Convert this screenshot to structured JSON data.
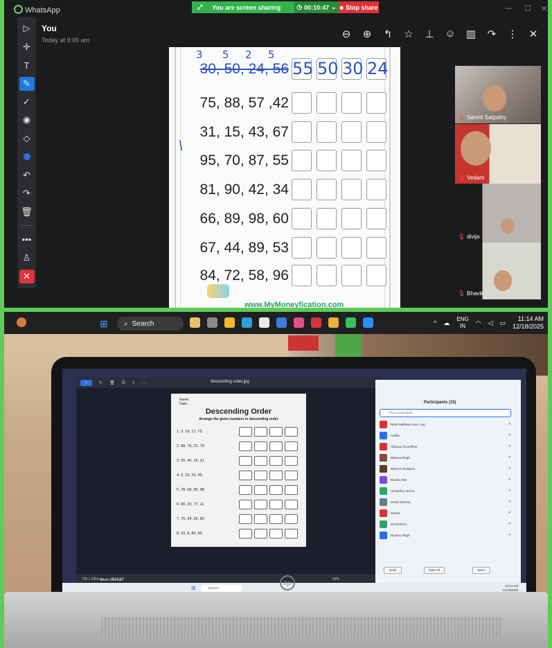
{
  "window": {
    "app_title": "WhatsApp",
    "minimize": "—",
    "maximize": "☐",
    "close": "✕"
  },
  "share_bar": {
    "status": "You are screen sharing",
    "timer": "00:10:47",
    "stop_label": "Stop share"
  },
  "viewer": {
    "sender": "You",
    "timestamp": "Today at 9:05 am",
    "actions": [
      "zoom-out-icon",
      "zoom-in-icon",
      "reply-icon",
      "star-icon",
      "pin-icon",
      "emoji-icon",
      "delete-icon",
      "forward-icon",
      "more-icon",
      "close-icon"
    ]
  },
  "toolbar": {
    "tools": [
      "select-icon",
      "move-icon",
      "text-icon",
      "pen-icon",
      "check-icon",
      "highlight-icon",
      "eraser-icon",
      "color-icon",
      "undo-icon",
      "redo-icon",
      "delete-icon",
      "more-icon",
      "share-icon",
      "close-icon"
    ]
  },
  "worksheet": {
    "rows": [
      {
        "numbers": "30, 50, 24, 56",
        "answers": [
          "55",
          "50",
          "30",
          "24"
        ]
      },
      {
        "numbers": "75, 88, 57 ,42",
        "answers": [
          "",
          "",
          "",
          ""
        ]
      },
      {
        "numbers": "31, 15, 43, 67",
        "answers": [
          "",
          "",
          "",
          ""
        ]
      },
      {
        "numbers": "95, 70, 87, 55",
        "answers": [
          "",
          "",
          "",
          ""
        ]
      },
      {
        "numbers": "81, 90, 42, 34",
        "answers": [
          "",
          "",
          "",
          ""
        ]
      },
      {
        "numbers": "66, 89, 98, 60",
        "answers": [
          "",
          "",
          "",
          ""
        ]
      },
      {
        "numbers": "67, 44, 89, 53",
        "answers": [
          "",
          "",
          "",
          ""
        ]
      },
      {
        "numbers": "84, 72, 58, 96",
        "answers": [
          "",
          "",
          "",
          ""
        ]
      }
    ],
    "footer": "www.MyMoneyfication.com"
  },
  "participants_video": [
    {
      "name": "Samrit Satpathy"
    },
    {
      "name": "Vedant"
    },
    {
      "name": "divija"
    },
    {
      "name": "Bhavik"
    }
  ],
  "taskbar": {
    "search_placeholder": "Search",
    "lang_1": "ENG",
    "lang_2": "IN",
    "time": "11:14 AM",
    "date": "12/18/2025"
  },
  "laptop_screen": {
    "doc_title": "descending order.jpg",
    "paper_name": "Name:",
    "paper_date": "Date:",
    "paper_title": "Descending Order",
    "paper_subtitle": "Arrange the given numbers in descending order",
    "paper_rows": [
      "1.  9,  19,  17,  75",
      "2.  88,  79,  21,  70",
      "3.  25,  40,  15,  31",
      "4.  2,  13,  24,  49",
      "5.  78,  99,  90,  98",
      "6.  66,  33,  77,  11",
      "7.  76,  34,  65,  56",
      "8.  10,  8,  80,  90"
    ],
    "doc_status": "736 x 1064 px",
    "doc_size": "87.6 KB",
    "zoom": "55%",
    "caption": "Smriti Sharma",
    "participants_title": "Participants (15)",
    "find_placeholder": "Find a participant",
    "participants": [
      {
        "name": "Neha Mathew (Host, me)",
        "color": "#d9332e"
      },
      {
        "name": "Aadita",
        "color": "#2a6ee8"
      },
      {
        "name": "Abhaya Choudhary",
        "color": "#d9332e"
      },
      {
        "name": "Bhavya Singh",
        "color": "#7a4d3a"
      },
      {
        "name": "SHRUTI BANSAL",
        "color": "#5a3a2a"
      },
      {
        "name": "Devika K05",
        "color": "#7b4be0"
      },
      {
        "name": "Himanshu Verma",
        "color": "#2fa46a"
      },
      {
        "name": "Smriti Sharma",
        "color": "#6a7b8c"
      },
      {
        "name": "Sakshi",
        "color": "#d9332e"
      },
      {
        "name": "DIVIJA/ETA",
        "color": "#2fa46a"
      },
      {
        "name": "Riyansi Singh",
        "color": "#2a6ee8"
      }
    ],
    "btn_invite": "Invite",
    "btn_mute_all": "Mute All",
    "btn_more": "More",
    "tb_search": "Search",
    "tb_time": "11:14 AM",
    "tb_date": "12/18/2025"
  }
}
